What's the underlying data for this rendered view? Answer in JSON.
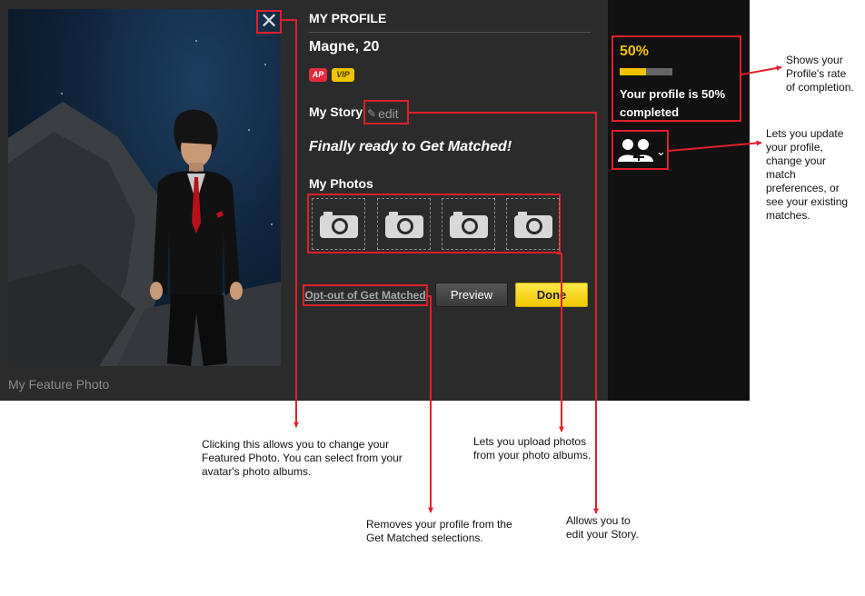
{
  "feature_photo": {
    "caption": "My Feature Photo"
  },
  "profile": {
    "section_title": "MY PROFILE",
    "name_age": "Magne, 20",
    "badges": [
      "AP",
      "VIP"
    ],
    "story_label": "My Story",
    "edit_label": "edit",
    "story_text": "Finally ready to Get Matched!",
    "photos_label": "My Photos",
    "photo_slot_icon": "camera-icon",
    "optout_label": "Opt-out of Get Matched",
    "preview_label": "Preview",
    "done_label": "Done"
  },
  "completion": {
    "percent_label": "50%",
    "progress": 0.5,
    "text": "Your profile is 50% completed"
  },
  "match_menu": {
    "icon": "users-icon",
    "chevron": "chevron-down-icon"
  },
  "annotations": {
    "completion_note": "Shows your\nProfile's rate\nof completion.",
    "match_menu_note": "Lets you update\nyour profile,\nchange your\nmatch\npreferences, or\nsee your existing\nmatches.",
    "feature_photo_note": "Clicking this allows you to change your\nFeatured Photo. You can select from your\navatar's photo albums.",
    "photos_note": "Lets you upload photos\nfrom your photo albums.",
    "optout_note": "Removes your profile from the\nGet Matched selections.",
    "edit_note": "Allows you to\nedit your Story."
  },
  "colors": {
    "accent_yellow": "#f2c200",
    "annotation_red": "#e0202a",
    "panel_bg": "#2b2b2b",
    "sidebar_bg": "#111111"
  }
}
